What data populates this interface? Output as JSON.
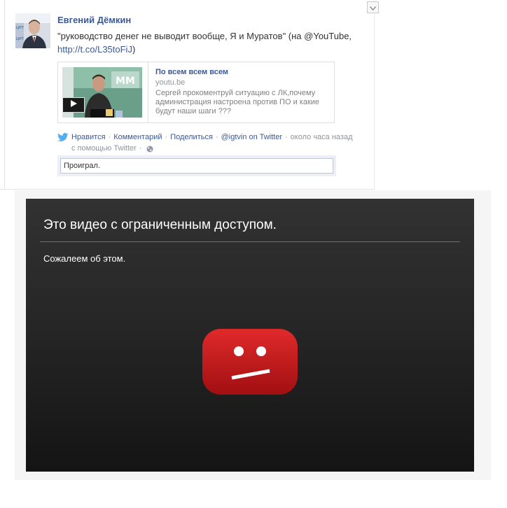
{
  "post": {
    "author": "Евгений Дёмкин",
    "text": "\"руководство денег не выводит вообще, Я и Муратов\" (на @YouTube,",
    "link": "http://t.co/L35toFiJ",
    "link_suffix": ")",
    "menu_icon": "chevron-down-icon"
  },
  "attachment": {
    "title": "По всем всем всем",
    "domain": "youtu.be",
    "description": "Сергей прокоментруй ситуацию с ЛК,почему администрация настроена против ПО и какие будут наши шаги ???",
    "play_icon": "play-icon"
  },
  "actions": {
    "source_icon": "twitter-bird-icon",
    "like": "Нравится",
    "comment": "Комментарий",
    "share": "Поделиться",
    "via": "@igtvin on Twitter",
    "time": "около часа назад",
    "with_help": "с помощью Twitter",
    "separator": "·",
    "privacy_icon": "globe-icon"
  },
  "comment": {
    "value": "Проиграл."
  },
  "video": {
    "title": "Это видео с ограниченным доступом.",
    "message": "Сожалеем об этом.",
    "icon": "sad-youtube-icon"
  },
  "colors": {
    "link": "#3b5998",
    "youtube_red": "#cc181e",
    "player_bg": "#252525"
  }
}
